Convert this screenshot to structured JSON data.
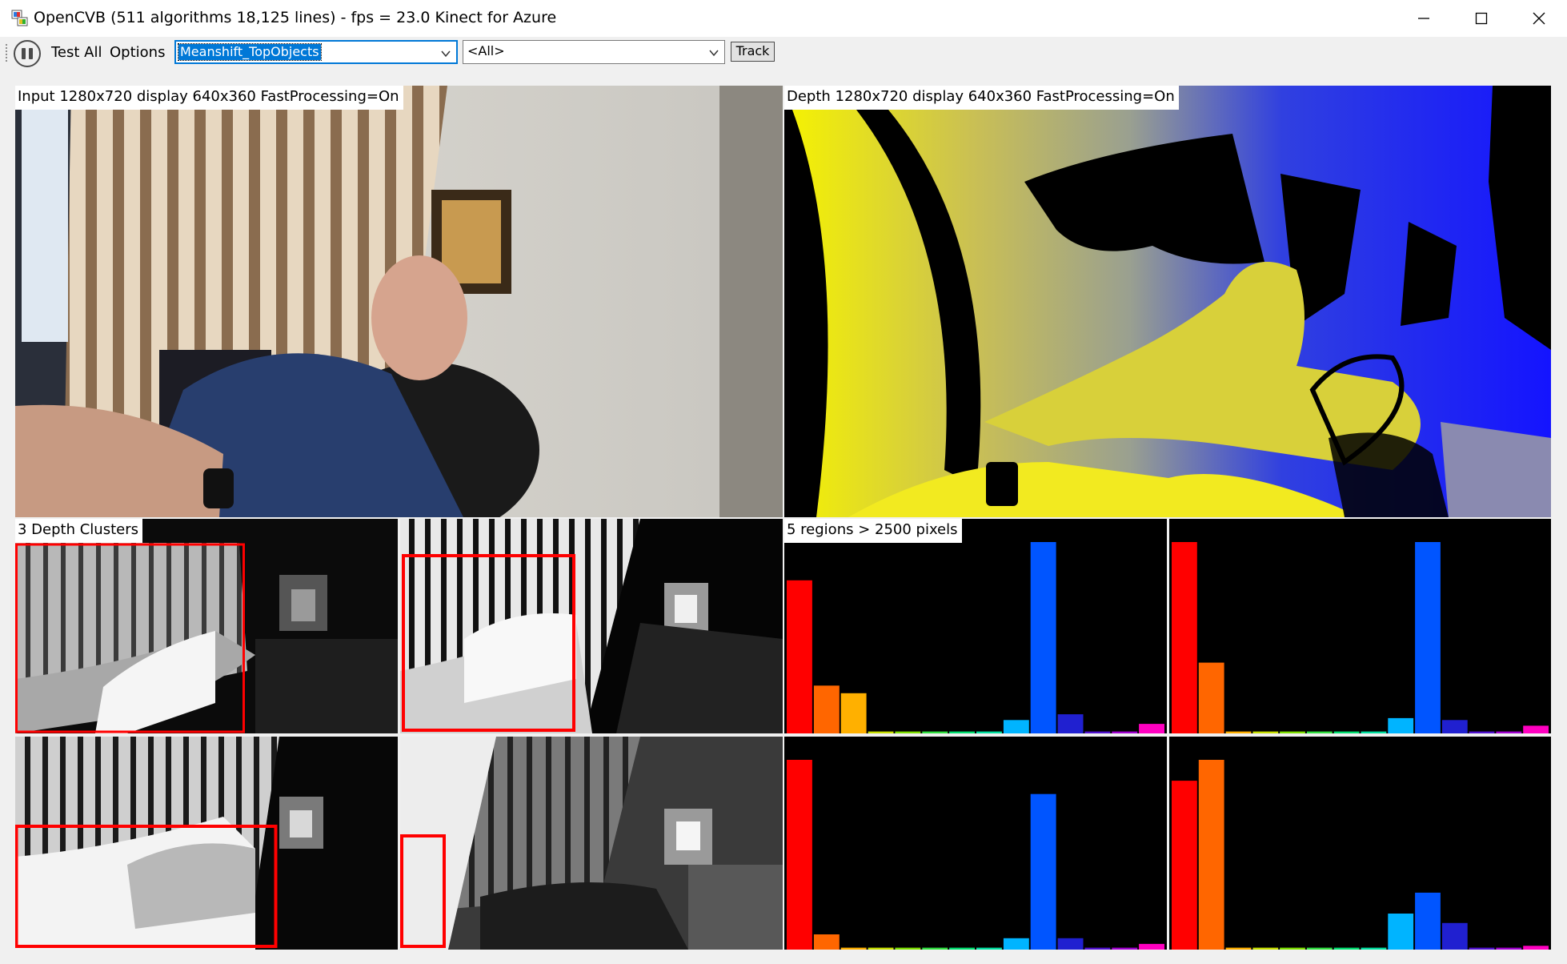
{
  "window": {
    "title": "OpenCVB (511 algorithms 18,125 lines) - fps = 23.0 Kinect for Azure"
  },
  "toolbar": {
    "test_all_label": "Test All",
    "options_label": "Options",
    "algorithm_value": "Meanshift_TopObjects",
    "group_value": "<All>",
    "track_label": "Track"
  },
  "panels": {
    "input_label": "Input  1280x720  display  640x360  FastProcessing=On",
    "depth_label": "Depth  1280x720  display  640x360  FastProcessing=On",
    "clusters_label": "3 Depth Clusters",
    "regions_label": "5 regions > 2500 pixels"
  },
  "histogram_panels": [
    {
      "values": [
        0.8,
        0.25,
        0.21,
        0.01,
        0.01,
        0.01,
        0.01,
        0.01,
        0.07,
        1.0,
        0.1,
        0.01,
        0.01,
        0.05
      ]
    },
    {
      "values": [
        1.0,
        0.37,
        0.01,
        0.01,
        0.01,
        0.01,
        0.01,
        0.01,
        0.08,
        1.0,
        0.07,
        0.01,
        0.01,
        0.04
      ]
    },
    {
      "values": [
        1.0,
        0.08,
        0.01,
        0.01,
        0.01,
        0.01,
        0.01,
        0.01,
        0.06,
        0.82,
        0.06,
        0.01,
        0.01,
        0.03
      ]
    },
    {
      "values": [
        0.89,
        1.0,
        0.01,
        0.01,
        0.01,
        0.01,
        0.01,
        0.01,
        0.19,
        0.3,
        0.14,
        0.01,
        0.01,
        0.02
      ]
    }
  ],
  "histogram_colors": [
    "#ff0000",
    "#ff6600",
    "#ffb000",
    "#c8e000",
    "#7ee000",
    "#30e040",
    "#00e070",
    "#00e0a0",
    "#00b4ff",
    "#0055ff",
    "#2020d0",
    "#5010d0",
    "#a000d0",
    "#ff00c0"
  ],
  "colors": {
    "selection": "#0078d7",
    "roi_box": "#ff0000"
  }
}
